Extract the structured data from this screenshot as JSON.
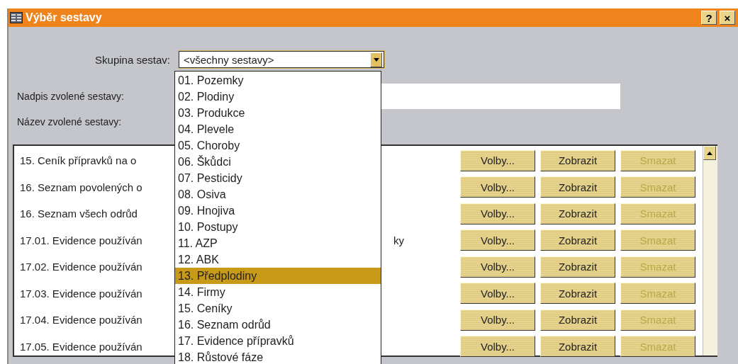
{
  "window": {
    "title": "Výběr sestavy",
    "help_button": "?",
    "close_button": "×"
  },
  "group": {
    "label": "Skupina sestav:",
    "value": "<všechny sestavy>",
    "expanded": true
  },
  "caption_field": {
    "label": "Nadpis zvolené sestavy:"
  },
  "name_field": {
    "label": "Název zvolené sestavy:"
  },
  "dropdown": [
    {
      "label": "01. Pozemky",
      "selected": false
    },
    {
      "label": "02. Plodiny",
      "selected": false
    },
    {
      "label": "03. Produkce",
      "selected": false
    },
    {
      "label": "04. Plevele",
      "selected": false
    },
    {
      "label": "05. Choroby",
      "selected": false
    },
    {
      "label": "06. Škůdci",
      "selected": false
    },
    {
      "label": "07. Pesticidy",
      "selected": false
    },
    {
      "label": "08. Osiva",
      "selected": false
    },
    {
      "label": "09. Hnojiva",
      "selected": false
    },
    {
      "label": "10. Postupy",
      "selected": false
    },
    {
      "label": "11. AZP",
      "selected": false
    },
    {
      "label": "12. ABK",
      "selected": false
    },
    {
      "label": "13. Předplodiny",
      "selected": true
    },
    {
      "label": "14. Firmy",
      "selected": false
    },
    {
      "label": "15. Ceníky",
      "selected": false
    },
    {
      "label": "16. Seznam odrůd",
      "selected": false
    },
    {
      "label": "17. Evidence přípravků",
      "selected": false
    },
    {
      "label": "18. Růstové fáze",
      "selected": false
    }
  ],
  "reports": [
    {
      "name": "15. Ceník přípravků na o",
      "buttons": [
        {
          "label": "Volby...",
          "disabled": false
        },
        {
          "label": "Zobrazit",
          "disabled": false
        },
        {
          "label": "Smazat",
          "disabled": true
        }
      ]
    },
    {
      "name": "16. Seznam povolených o",
      "buttons": [
        {
          "label": "Volby...",
          "disabled": false
        },
        {
          "label": "Zobrazit",
          "disabled": false
        },
        {
          "label": "Smazat",
          "disabled": true
        }
      ]
    },
    {
      "name": "16. Seznam všech odrůd",
      "buttons": [
        {
          "label": "Volby...",
          "disabled": false
        },
        {
          "label": "Zobrazit",
          "disabled": false
        },
        {
          "label": "Smazat",
          "disabled": true
        }
      ]
    },
    {
      "name": "17.01. Evidence používán",
      "tail": "ky",
      "buttons": [
        {
          "label": "Volby...",
          "disabled": false
        },
        {
          "label": "Zobrazit",
          "disabled": false
        },
        {
          "label": "Smazat",
          "disabled": true
        }
      ]
    },
    {
      "name": "17.02. Evidence používán",
      "buttons": [
        {
          "label": "Volby...",
          "disabled": false
        },
        {
          "label": "Zobrazit",
          "disabled": false
        },
        {
          "label": "Smazat",
          "disabled": true
        }
      ]
    },
    {
      "name": "17.03. Evidence používán",
      "buttons": [
        {
          "label": "Volby...",
          "disabled": false
        },
        {
          "label": "Zobrazit",
          "disabled": false
        },
        {
          "label": "Smazat",
          "disabled": true
        }
      ]
    },
    {
      "name": "17.04. Evidence používán",
      "buttons": [
        {
          "label": "Volby...",
          "disabled": false
        },
        {
          "label": "Zobrazit",
          "disabled": false
        },
        {
          "label": "Smazat",
          "disabled": true
        }
      ]
    },
    {
      "name": "17.05. Evidence používán",
      "buttons": [
        {
          "label": "Volby...",
          "disabled": false
        },
        {
          "label": "Zobrazit",
          "disabled": false
        },
        {
          "label": "Smazat",
          "disabled": true
        }
      ]
    }
  ]
}
